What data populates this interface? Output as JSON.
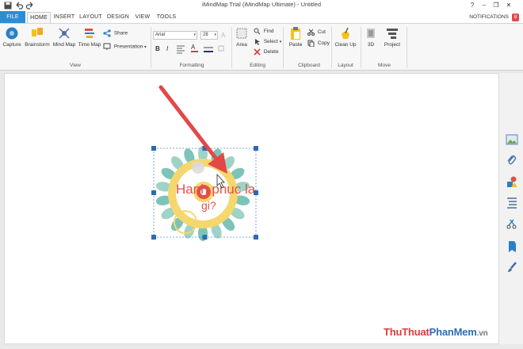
{
  "window": {
    "title": "iMindMap Trial (iMindMap Ultimate) - Untitled",
    "controls": [
      "?",
      "–",
      "❐",
      "✕"
    ]
  },
  "tabs": [
    {
      "label": "FILE"
    },
    {
      "label": "HOME"
    },
    {
      "label": "INSERT"
    },
    {
      "label": "LAYOUT"
    },
    {
      "label": "DESIGN"
    },
    {
      "label": "VIEW"
    },
    {
      "label": "TOOLS"
    }
  ],
  "notifications": {
    "label": "NOTIFICATIONS",
    "count": "8"
  },
  "ribbon": {
    "view": {
      "capture": "Capture",
      "brainstorm": "Brainstorm",
      "mind_map": "Mind Map",
      "time_map": "Time Map",
      "share": "Share",
      "presentation": "Presentation",
      "group": "View"
    },
    "formatting": {
      "font_name": "Arial",
      "font_size": "28",
      "bold": "B",
      "italic": "I",
      "text_color": "A",
      "group": "Formatting"
    },
    "editing": {
      "area": "Area",
      "find": "Find",
      "select": "Select",
      "delete": "Delete",
      "group": "Editing"
    },
    "clipboard": {
      "paste": "Paste",
      "cut": "Cut",
      "copy": "Copy",
      "group": "Clipboard"
    },
    "layout": {
      "clean_up": "Clean Up",
      "group": "Layout"
    },
    "move": {
      "three_d": "3D",
      "project": "Project",
      "group": "Move"
    }
  },
  "central_idea": {
    "text_line1": "Hanh phuc la",
    "text_line2": "gi?"
  },
  "colors": {
    "accent": "#2b8dd6",
    "badge": "#e04a4a",
    "arrow": "#e24848",
    "handle": "#2b6cb0"
  },
  "right_panel": {
    "icons": [
      "image-icon",
      "attachment-icon",
      "shapes-icon",
      "outline-icon",
      "clipart-icon",
      "tag-icon",
      "brush-icon"
    ]
  },
  "watermark": {
    "part1": "ThuThuat",
    "part2": "PhanMem",
    "part3": ".vn"
  }
}
